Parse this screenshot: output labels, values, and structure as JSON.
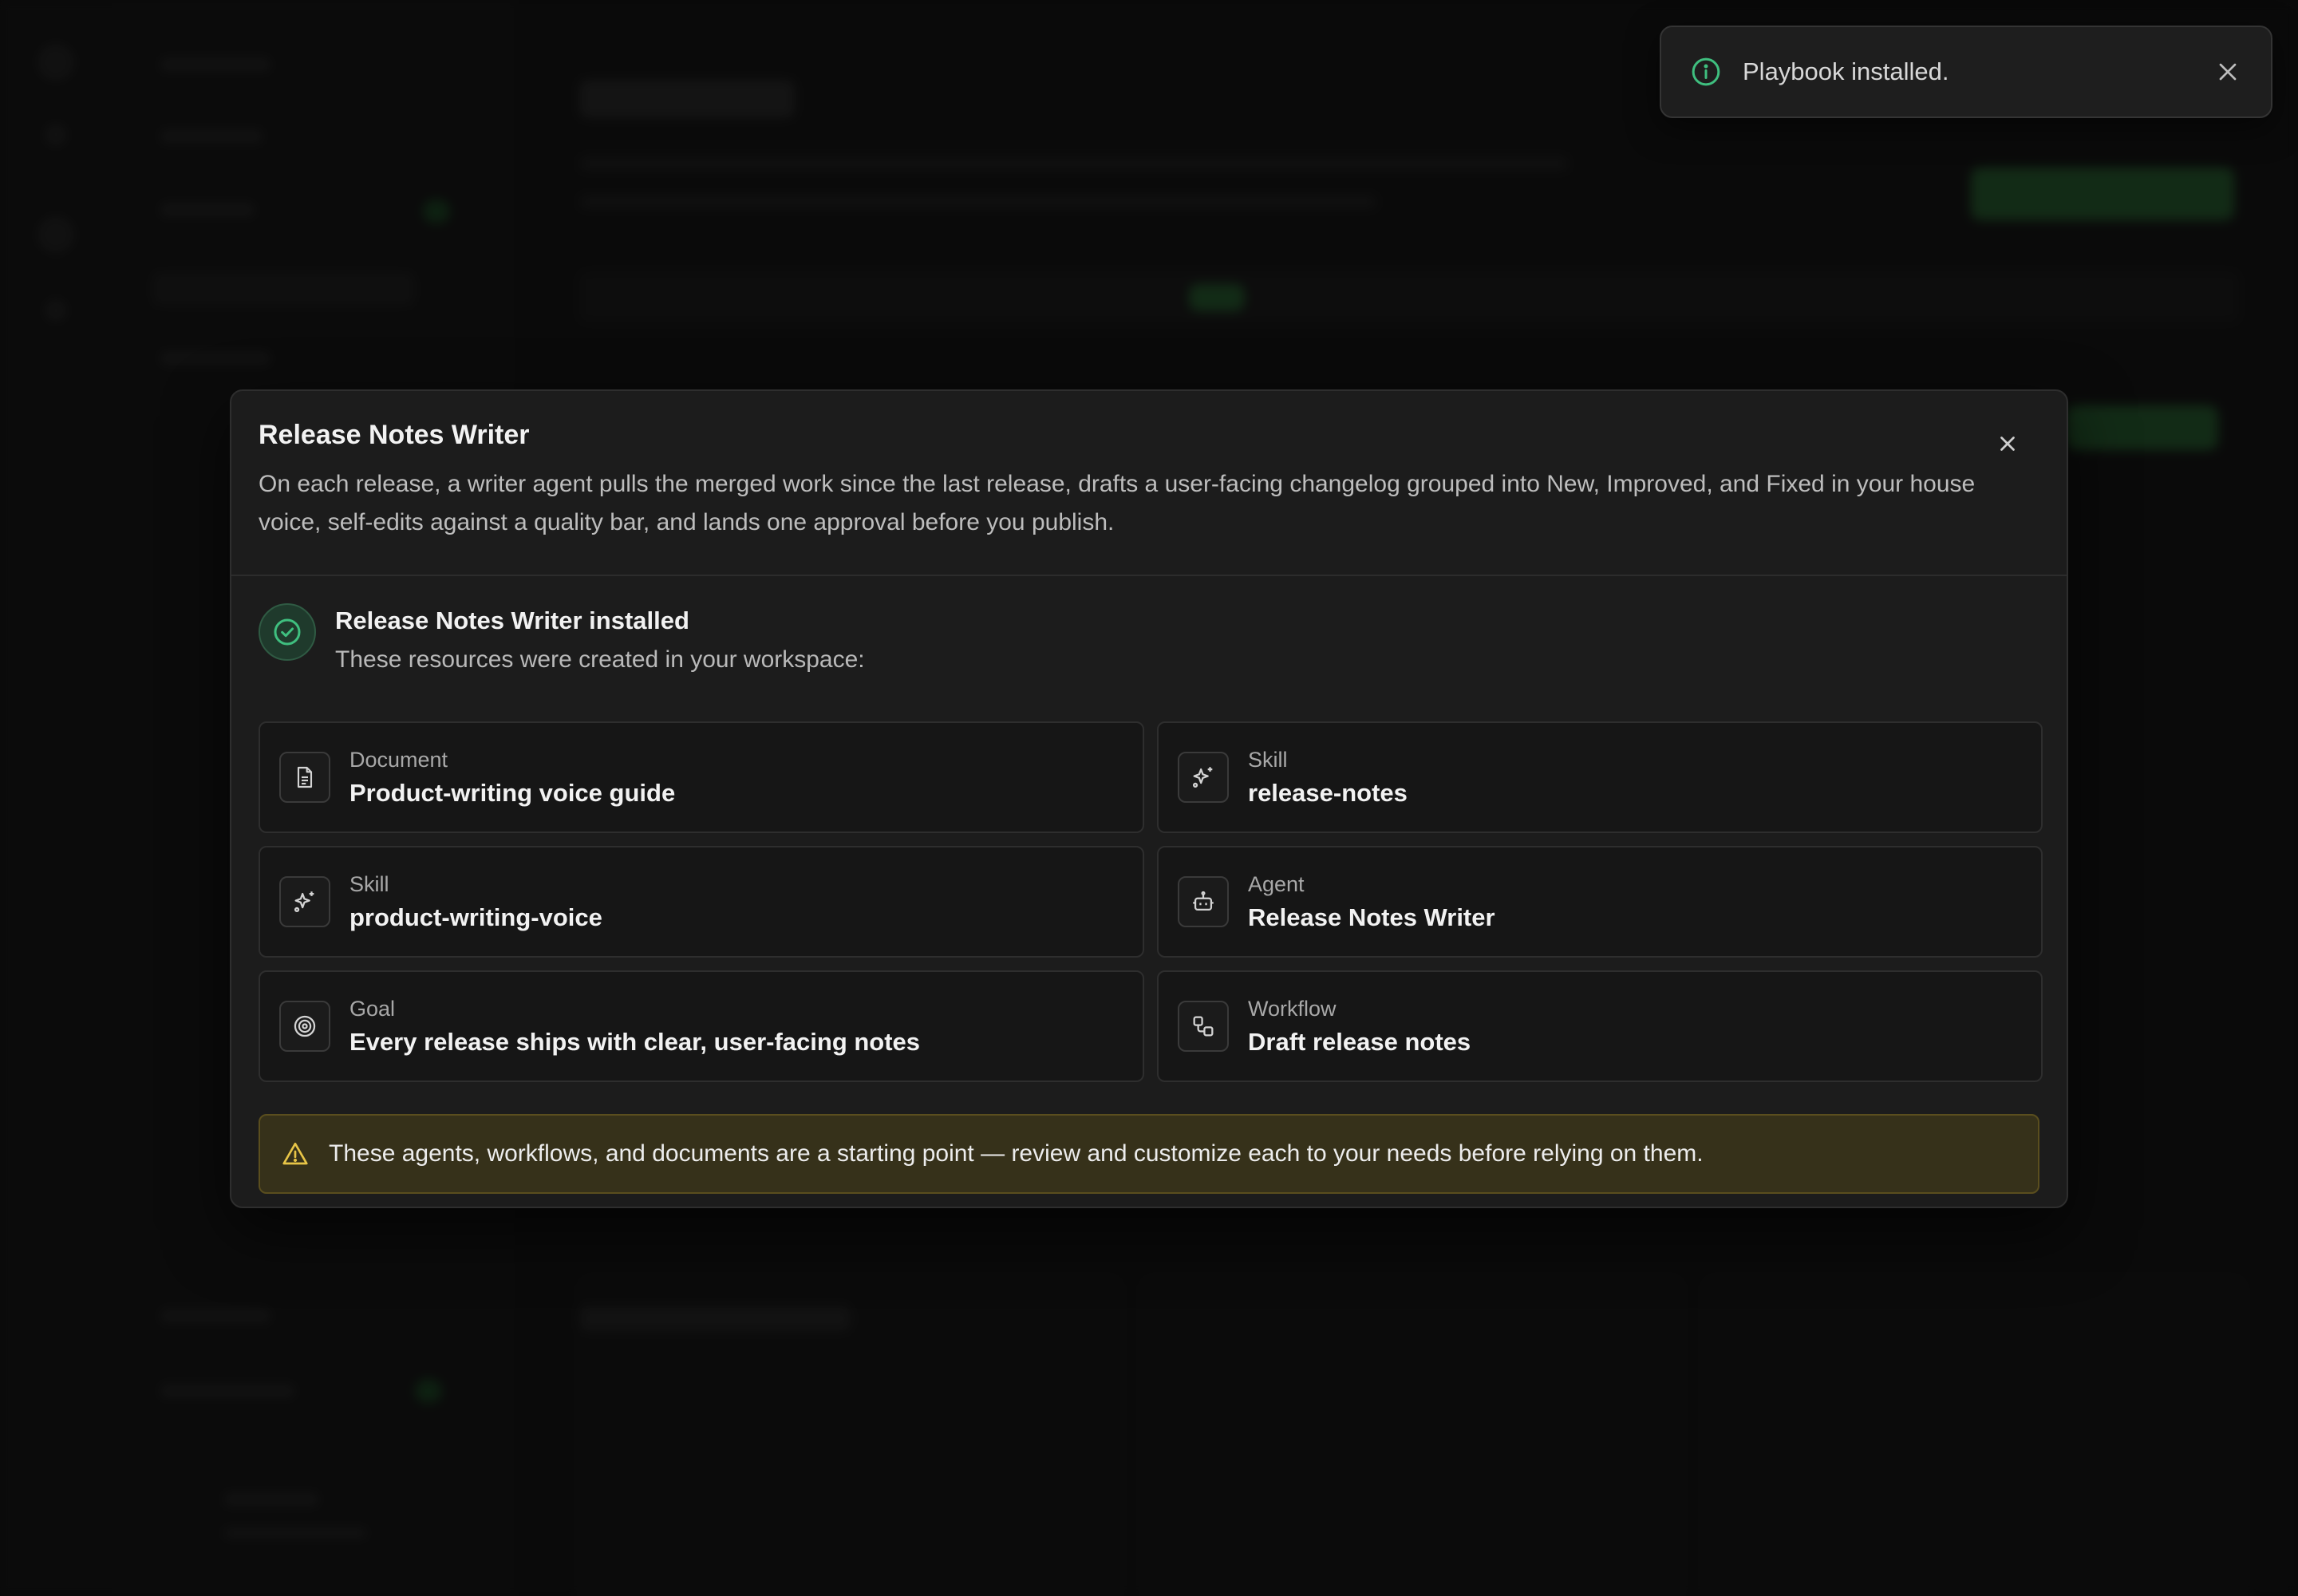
{
  "toast": {
    "message": "Playbook installed."
  },
  "modal": {
    "title": "Release Notes Writer",
    "description": "On each release, a writer agent pulls the merged work since the last release, drafts a user-facing changelog grouped into New, Improved, and Fixed in your house voice, self-edits against a quality bar, and lands one approval before you publish.",
    "installed_title": "Release Notes Writer installed",
    "installed_subtitle": "These resources were created in your workspace:",
    "resources": [
      {
        "kind": "Document",
        "name": "Product-writing voice guide",
        "icon": "document-icon"
      },
      {
        "kind": "Skill",
        "name": "release-notes",
        "icon": "sparkles-icon"
      },
      {
        "kind": "Skill",
        "name": "product-writing-voice",
        "icon": "sparkles-icon"
      },
      {
        "kind": "Agent",
        "name": "Release Notes Writer",
        "icon": "robot-icon"
      },
      {
        "kind": "Goal",
        "name": "Every release ships with clear, user-facing notes",
        "icon": "target-icon"
      },
      {
        "kind": "Workflow",
        "name": "Draft release notes",
        "icon": "workflow-icon"
      }
    ],
    "warning": "These agents, workflows, and documents are a starting point — review and customize each to your needs before relying on them."
  },
  "colors": {
    "background": "#111111",
    "modal": "#1c1c1c",
    "success": "#3fbf7f",
    "warning_bg": "#36311a",
    "warning_icon": "#e8c547"
  }
}
